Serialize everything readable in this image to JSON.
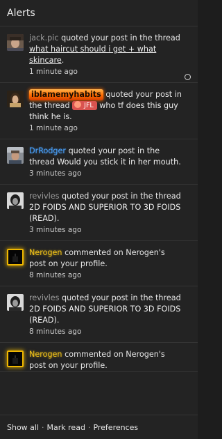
{
  "header": {
    "title": "Alerts"
  },
  "alerts": [
    {
      "user": "jack.pic",
      "action": "quoted your post in the thread",
      "thread": "what haircut should i get + what skincare",
      "thread_suffix": ".",
      "time": "1 minute ago",
      "avatar": "portrait-avatar"
    },
    {
      "user": "iblamemyhabits",
      "action": "quoted your post in the thread",
      "prefix": "JFL",
      "thread": "who tf does this guy think he is.",
      "time": "1 minute ago",
      "avatar": "portrait-avatar"
    },
    {
      "user": "DrRodger",
      "action": "quoted your post in the thread",
      "thread": "Would you stick it in her mouth.",
      "time": "3 minutes ago",
      "avatar": "portrait-avatar"
    },
    {
      "user": "revivles",
      "action": "quoted your post in the thread",
      "thread": "2D FOIDS AND SUPERIOR TO 3D FOIDS (READ).",
      "time": "3 minutes ago",
      "avatar": "portrait-avatar"
    },
    {
      "user": "Nerogen",
      "action": "commented on Nerogen's post on your profile.",
      "time": "8 minutes ago",
      "avatar": "dark-avatar"
    },
    {
      "user": "revivles",
      "action": "quoted your post in the thread",
      "thread": "2D FOIDS AND SUPERIOR TO 3D FOIDS (READ).",
      "time": "8 minutes ago",
      "avatar": "portrait-avatar"
    },
    {
      "user": "Nerogen",
      "action": "commented on Nerogen's post on your profile.",
      "avatar": "dark-avatar"
    }
  ],
  "footer": {
    "show_all": "Show all",
    "separator": "·",
    "mark_read": "Mark read",
    "preferences": "Preferences"
  },
  "colors": {
    "background": "#232323",
    "username_gray": "#9c9c9c",
    "username_blue": "#4aa3ff",
    "username_gold": "#f3c419",
    "fire_orange": "#ff6a00",
    "prefix_red": "#d9534f"
  }
}
